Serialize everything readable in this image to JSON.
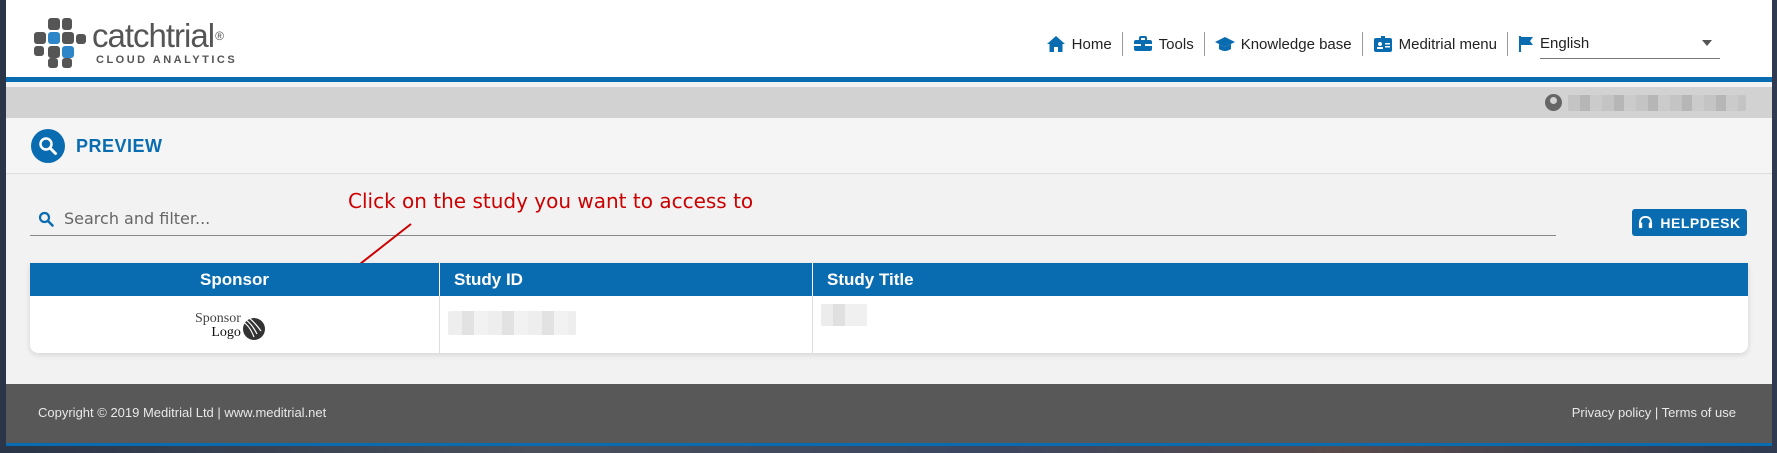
{
  "brand": {
    "name": "catchtrial",
    "registered": "®",
    "subtitle": "CLOUD ANALYTICS"
  },
  "nav": {
    "items": [
      {
        "label": "Home",
        "icon": "home-icon"
      },
      {
        "label": "Tools",
        "icon": "toolbox-icon"
      },
      {
        "label": "Knowledge base",
        "icon": "graduation-cap-icon"
      },
      {
        "label": "Meditrial menu",
        "icon": "id-card-icon"
      }
    ],
    "language": {
      "icon": "flag-icon",
      "selected": "English"
    }
  },
  "page": {
    "title": "PREVIEW",
    "icon": "search-icon"
  },
  "search": {
    "placeholder": "Search and filter..."
  },
  "annotation": "Click on the study you want to access to",
  "helpdesk": {
    "label": "HELPDESK",
    "icon": "headset-icon"
  },
  "table": {
    "headers": [
      "Sponsor",
      "Study ID",
      "Study Title"
    ],
    "rows": [
      {
        "sponsor_logo": {
          "line1": "Sponsor",
          "line2": "Logo"
        }
      }
    ]
  },
  "footer": {
    "copyright": "Copyright © 2019 Meditrial Ltd | www.meditrial.net",
    "privacy": "Privacy policy",
    "separator": " | ",
    "terms": "Terms of use"
  },
  "colors": {
    "primary": "#0a6cb0",
    "annotation": "#cc0000",
    "footer": "#585858"
  }
}
